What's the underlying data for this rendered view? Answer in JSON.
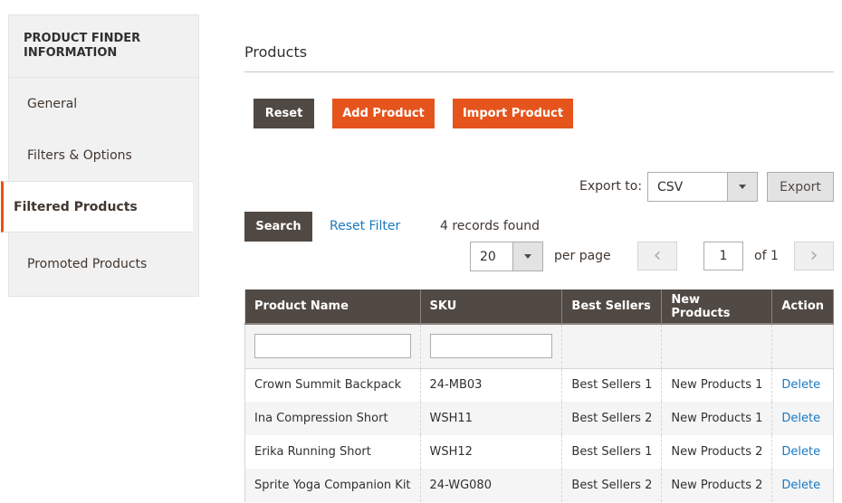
{
  "sidebar": {
    "title": "PRODUCT FINDER INFORMATION",
    "items": [
      {
        "label": "General",
        "active": false
      },
      {
        "label": "Filters & Options",
        "active": false
      },
      {
        "label": "Filtered Products",
        "active": true
      },
      {
        "label": "Promoted Products",
        "active": false
      }
    ]
  },
  "section": {
    "title": "Products"
  },
  "toolbar": {
    "reset_label": "Reset",
    "add_product_label": "Add Product",
    "import_product_label": "Import Product"
  },
  "export": {
    "label": "Export to:",
    "selected": "CSV",
    "button_label": "Export"
  },
  "grid_actions": {
    "search_label": "Search",
    "reset_filter_label": "Reset Filter",
    "records_found": "4 records found"
  },
  "pagination": {
    "per_page_value": "20",
    "per_page_label": "per page",
    "current_page": "1",
    "total_pages_label": "of 1",
    "prev_icon": "‹",
    "next_icon": "›"
  },
  "table": {
    "columns": [
      "Product Name",
      "SKU",
      "Best Sellers",
      "New Products",
      "Action"
    ],
    "filters": {
      "product_name": "",
      "sku": ""
    },
    "rows": [
      {
        "name": "Crown Summit Backpack",
        "sku": "24-MB03",
        "best_sellers": "Best Sellers 1",
        "new_products": "New Products 1",
        "action": "Delete"
      },
      {
        "name": "Ina Compression Short",
        "sku": "WSH11",
        "best_sellers": "Best Sellers 2",
        "new_products": "New Products 1",
        "action": "Delete"
      },
      {
        "name": "Erika Running Short",
        "sku": "WSH12",
        "best_sellers": "Best Sellers 1",
        "new_products": "New Products 2",
        "action": "Delete"
      },
      {
        "name": "Sprite Yoga Companion Kit",
        "sku": "24-WG080",
        "best_sellers": "Best Sellers 2",
        "new_products": "New Products 2",
        "action": "Delete"
      }
    ]
  },
  "colors": {
    "accent": "#eb5202",
    "primary_button": "#e5541c",
    "dark_button": "#514943",
    "link": "#1979c3"
  }
}
